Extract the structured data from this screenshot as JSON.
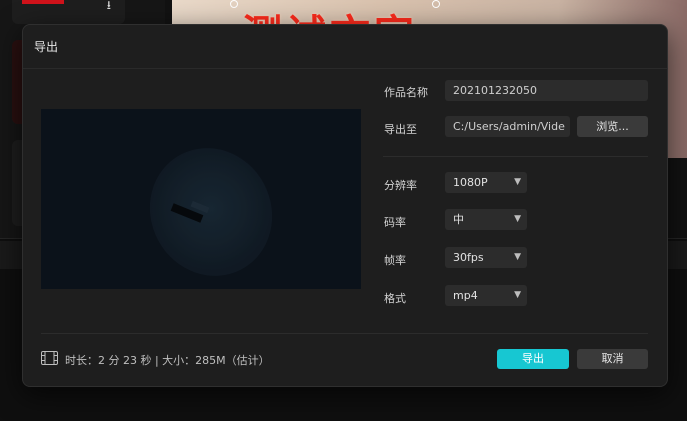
{
  "background": {
    "video_watermark": "测试文字"
  },
  "dialog": {
    "title": "导出",
    "work_name_label": "作品名称",
    "work_name_value": "202101232050",
    "export_to_label": "导出至",
    "export_path_value": "C:/Users/admin/Vide",
    "browse_label": "浏览...",
    "resolution_label": "分辨率",
    "resolution_value": "1080P",
    "bitrate_label": "码率",
    "bitrate_value": "中",
    "framerate_label": "帧率",
    "framerate_value": "30fps",
    "format_label": "格式",
    "format_value": "mp4",
    "info_text": "时长：2 分 23 秒 | 大小：285M（估计）",
    "export_button": "导出",
    "cancel_button": "取消"
  },
  "colors": {
    "accent": "#17c7d2",
    "dialog_bg": "#1e1e1e"
  },
  "icons": [
    "download-icon",
    "chevron-down-icon",
    "film-icon"
  ]
}
